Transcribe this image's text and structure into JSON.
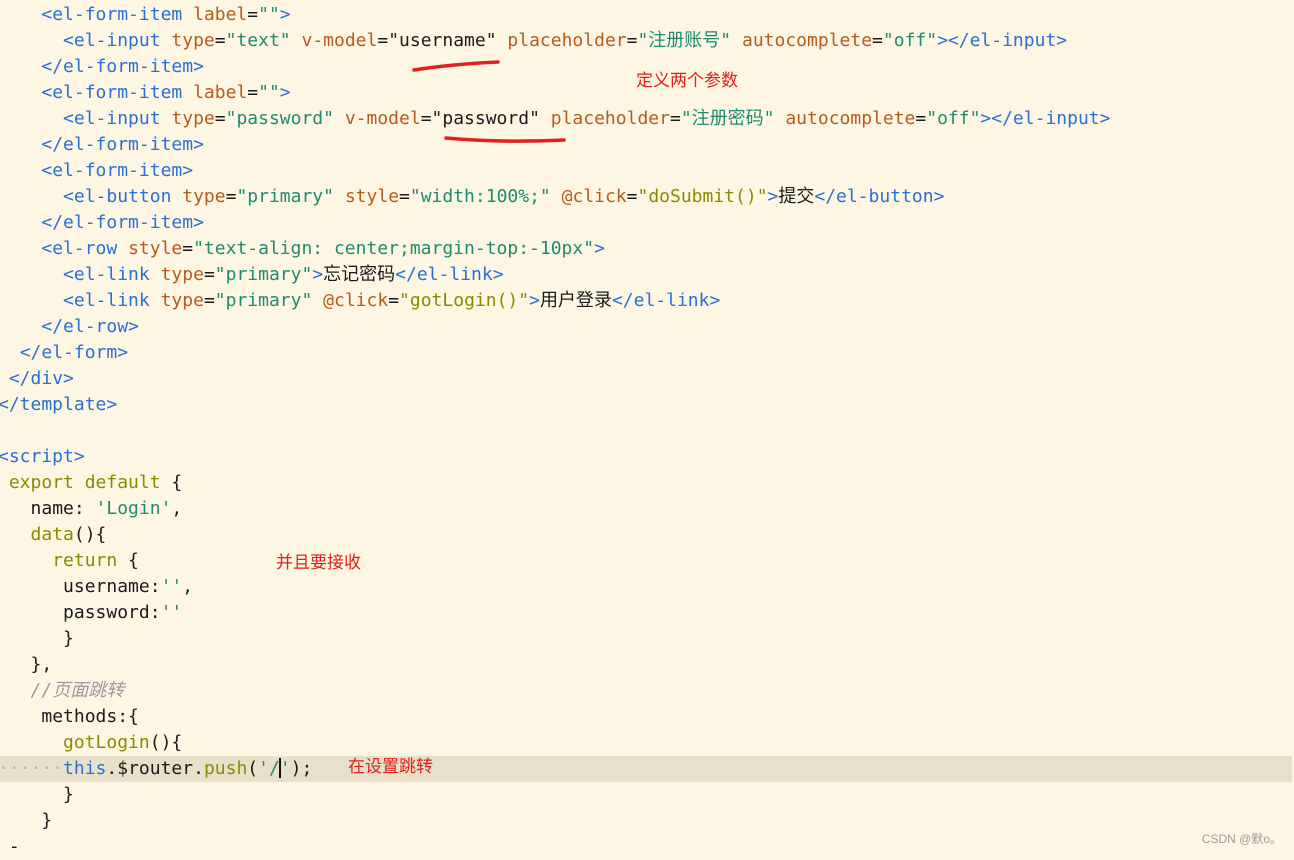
{
  "code": {
    "lines": [
      [
        {
          "c": "ws",
          "t": "    "
        },
        {
          "c": "tag",
          "t": "<el-form-item "
        },
        {
          "c": "attr",
          "t": "label"
        },
        {
          "c": "eq",
          "t": "="
        },
        {
          "c": "str",
          "t": "\"\""
        },
        {
          "c": "tag",
          "t": ">"
        }
      ],
      [
        {
          "c": "ws",
          "t": "      "
        },
        {
          "c": "tag",
          "t": "<el-input "
        },
        {
          "c": "attr",
          "t": "type"
        },
        {
          "c": "eq",
          "t": "="
        },
        {
          "c": "str",
          "t": "\"text\""
        },
        {
          "c": "prop",
          "t": " "
        },
        {
          "c": "attr",
          "t": "v-model"
        },
        {
          "c": "eq",
          "t": "="
        },
        {
          "c": "prop",
          "t": "\"username\""
        },
        {
          "c": "prop",
          "t": " "
        },
        {
          "c": "attr",
          "t": "placeholder"
        },
        {
          "c": "eq",
          "t": "="
        },
        {
          "c": "str",
          "t": "\"注册账号\""
        },
        {
          "c": "prop",
          "t": " "
        },
        {
          "c": "attr",
          "t": "autocomplete"
        },
        {
          "c": "eq",
          "t": "="
        },
        {
          "c": "str",
          "t": "\"off\""
        },
        {
          "c": "tag",
          "t": "></el-input>"
        }
      ],
      [
        {
          "c": "ws",
          "t": "    "
        },
        {
          "c": "tag",
          "t": "</el-form-item>"
        }
      ],
      [
        {
          "c": "ws",
          "t": "    "
        },
        {
          "c": "tag",
          "t": "<el-form-item "
        },
        {
          "c": "attr",
          "t": "label"
        },
        {
          "c": "eq",
          "t": "="
        },
        {
          "c": "str",
          "t": "\"\""
        },
        {
          "c": "tag",
          "t": ">"
        }
      ],
      [
        {
          "c": "ws",
          "t": "      "
        },
        {
          "c": "tag",
          "t": "<el-input "
        },
        {
          "c": "attr",
          "t": "type"
        },
        {
          "c": "eq",
          "t": "="
        },
        {
          "c": "str",
          "t": "\"password\""
        },
        {
          "c": "prop",
          "t": " "
        },
        {
          "c": "attr",
          "t": "v-model"
        },
        {
          "c": "eq",
          "t": "="
        },
        {
          "c": "prop",
          "t": "\"password\""
        },
        {
          "c": "prop",
          "t": " "
        },
        {
          "c": "attr",
          "t": "placeholder"
        },
        {
          "c": "eq",
          "t": "="
        },
        {
          "c": "str",
          "t": "\"注册密码\""
        },
        {
          "c": "prop",
          "t": " "
        },
        {
          "c": "attr",
          "t": "autocomplete"
        },
        {
          "c": "eq",
          "t": "="
        },
        {
          "c": "str",
          "t": "\"off\""
        },
        {
          "c": "tag",
          "t": "></el-input>"
        }
      ],
      [
        {
          "c": "ws",
          "t": "    "
        },
        {
          "c": "tag",
          "t": "</el-form-item>"
        }
      ],
      [
        {
          "c": "ws",
          "t": "    "
        },
        {
          "c": "tag",
          "t": "<el-form-item>"
        }
      ],
      [
        {
          "c": "ws",
          "t": "      "
        },
        {
          "c": "tag",
          "t": "<el-button "
        },
        {
          "c": "attr",
          "t": "type"
        },
        {
          "c": "eq",
          "t": "="
        },
        {
          "c": "str",
          "t": "\"primary\""
        },
        {
          "c": "prop",
          "t": " "
        },
        {
          "c": "attr",
          "t": "style"
        },
        {
          "c": "eq",
          "t": "="
        },
        {
          "c": "str",
          "t": "\"width:100%;\""
        },
        {
          "c": "prop",
          "t": " "
        },
        {
          "c": "attr",
          "t": "@click"
        },
        {
          "c": "eq",
          "t": "="
        },
        {
          "c": "fn",
          "t": "\"doSubmit()\""
        },
        {
          "c": "tag",
          "t": ">"
        },
        {
          "c": "prop",
          "t": "提交"
        },
        {
          "c": "tag",
          "t": "</el-button>"
        }
      ],
      [
        {
          "c": "ws",
          "t": "    "
        },
        {
          "c": "tag",
          "t": "</el-form-item>"
        }
      ],
      [
        {
          "c": "ws",
          "t": "    "
        },
        {
          "c": "tag",
          "t": "<el-row "
        },
        {
          "c": "attr",
          "t": "style"
        },
        {
          "c": "eq",
          "t": "="
        },
        {
          "c": "str",
          "t": "\"text-align: center;margin-top:-10px\""
        },
        {
          "c": "tag",
          "t": ">"
        }
      ],
      [
        {
          "c": "ws",
          "t": "      "
        },
        {
          "c": "tag",
          "t": "<el-link "
        },
        {
          "c": "attr",
          "t": "type"
        },
        {
          "c": "eq",
          "t": "="
        },
        {
          "c": "str",
          "t": "\"primary\""
        },
        {
          "c": "tag",
          "t": ">"
        },
        {
          "c": "prop",
          "t": "忘记密码"
        },
        {
          "c": "tag",
          "t": "</el-link>"
        }
      ],
      [
        {
          "c": "ws",
          "t": "      "
        },
        {
          "c": "tag",
          "t": "<el-link "
        },
        {
          "c": "attr",
          "t": "type"
        },
        {
          "c": "eq",
          "t": "="
        },
        {
          "c": "str",
          "t": "\"primary\""
        },
        {
          "c": "prop",
          "t": " "
        },
        {
          "c": "attr",
          "t": "@click"
        },
        {
          "c": "eq",
          "t": "="
        },
        {
          "c": "fn",
          "t": "\"gotLogin()\""
        },
        {
          "c": "tag",
          "t": ">"
        },
        {
          "c": "prop",
          "t": "用户登录"
        },
        {
          "c": "tag",
          "t": "</el-link>"
        }
      ],
      [
        {
          "c": "ws",
          "t": "    "
        },
        {
          "c": "tag",
          "t": "</el-row>"
        }
      ],
      [
        {
          "c": "ws",
          "t": "  "
        },
        {
          "c": "tag",
          "t": "</el-form>"
        }
      ],
      [
        {
          "c": "ws",
          "t": " "
        },
        {
          "c": "tag",
          "t": "</div>"
        }
      ],
      [
        {
          "c": "tag",
          "t": "</template>"
        }
      ],
      [],
      [
        {
          "c": "tag",
          "t": "<script>"
        }
      ],
      [
        {
          "c": "ws",
          "t": " "
        },
        {
          "c": "kw",
          "t": "export default"
        },
        {
          "c": "prop",
          "t": " {"
        }
      ],
      [
        {
          "c": "ws",
          "t": "   "
        },
        {
          "c": "prop",
          "t": "name: "
        },
        {
          "c": "str",
          "t": "'Login'"
        },
        {
          "c": "prop",
          "t": ","
        }
      ],
      [
        {
          "c": "ws",
          "t": "   "
        },
        {
          "c": "fn",
          "t": "data"
        },
        {
          "c": "prop",
          "t": "(){"
        }
      ],
      [
        {
          "c": "ws",
          "t": "     "
        },
        {
          "c": "kw",
          "t": "return"
        },
        {
          "c": "prop",
          "t": " {"
        }
      ],
      [
        {
          "c": "ws",
          "t": "      "
        },
        {
          "c": "prop",
          "t": "username:"
        },
        {
          "c": "str",
          "t": "''"
        },
        {
          "c": "prop",
          "t": ","
        }
      ],
      [
        {
          "c": "ws",
          "t": "      "
        },
        {
          "c": "prop",
          "t": "password:"
        },
        {
          "c": "str",
          "t": "''"
        }
      ],
      [
        {
          "c": "ws",
          "t": "      "
        },
        {
          "c": "prop",
          "t": "}"
        }
      ],
      [
        {
          "c": "ws",
          "t": "   "
        },
        {
          "c": "prop",
          "t": "},"
        }
      ],
      [
        {
          "c": "ws",
          "t": "   "
        },
        {
          "c": "comment",
          "t": "//页面跳转"
        }
      ],
      [
        {
          "c": "ws",
          "t": "    "
        },
        {
          "c": "prop",
          "t": "methods:{"
        }
      ],
      [
        {
          "c": "ws",
          "t": "      "
        },
        {
          "c": "fn",
          "t": "gotLogin"
        },
        {
          "c": "prop",
          "t": "(){"
        }
      ],
      [
        {
          "c": "ws",
          "t": "······"
        },
        {
          "c": "this",
          "t": "this"
        },
        {
          "c": "prop",
          "t": ".$router."
        },
        {
          "c": "fn",
          "t": "push"
        },
        {
          "c": "prop",
          "t": "("
        },
        {
          "c": "str",
          "t": "'/"
        },
        {
          "c": "caret",
          "t": ""
        },
        {
          "c": "str",
          "t": "'"
        },
        {
          "c": "prop",
          "t": ");"
        }
      ],
      [
        {
          "c": "ws",
          "t": "      "
        },
        {
          "c": "prop",
          "t": "}"
        }
      ],
      [
        {
          "c": "ws",
          "t": "    "
        },
        {
          "c": "prop",
          "t": "}"
        }
      ],
      [
        {
          "c": "ws",
          "t": " "
        },
        {
          "c": "prop",
          "t": "-"
        }
      ]
    ],
    "current_line": 29
  },
  "annotations": {
    "define_params": "定义两个参数",
    "and_receive": "并且要接收",
    "set_redirect": "在设置跳转"
  },
  "watermark": "CSDN @默o。",
  "colors": {
    "background": "#fdf6e3",
    "tag": "#2a6fd6",
    "attribute": "#b85a1c",
    "string": "#1f8a70",
    "keyword": "#8a8a00",
    "annotation": "#e0201a"
  }
}
